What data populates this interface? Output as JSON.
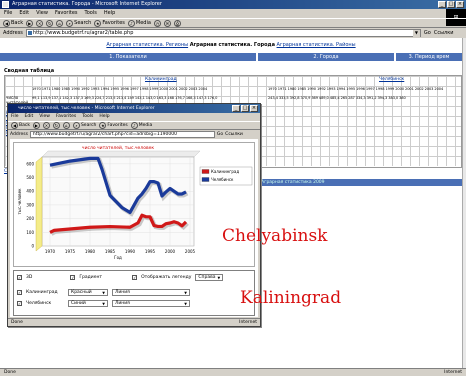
{
  "window": {
    "title": "Аграрная статистика. Города - Microsoft Internet Explorer",
    "menu": [
      "File",
      "Edit",
      "View",
      "Favorites",
      "Tools",
      "Help"
    ],
    "toolbar": {
      "back": "Back",
      "search": "Search",
      "favorites": "Favorites",
      "media": "Media"
    },
    "address_label": "Address",
    "address": "http://www.budgetrf.ru/agrar2/table.php",
    "go": "Go",
    "links": "Ссылки"
  },
  "page": {
    "nav": {
      "link1": "Аграрная статистика. Регионы",
      "current": "Аграрная статистика. Города",
      "link2": "Аграрная статистика. Районы"
    },
    "tabs": [
      "1. Показатели",
      "2. Города",
      "3. Период врем"
    ],
    "section_title": "Сводная таблица",
    "row_header": [
      "число",
      "читателей,",
      "тыс.человек"
    ],
    "row_links": [
      "Калининград",
      "Челябинск",
      "график",
      "отбор по",
      "городам"
    ],
    "city1": "Калининград",
    "city2": "Челябинск",
    "years_left": "1970 1971 1980 1985 1990 1992 1993 1994 1995 1996 1997 1998 1999 2000 2001 2002 2003 2004",
    "cells_left": "99,1 113,9 137,1 142,3 137,3 169,3 224,7 213,5 213,4 149 143,1 143,0 163,3 168 176,7 168,3 147,3 176,0",
    "years_right": "1970 1971 1980 1985 1990 1992 1993 1994 1995 1996 1997 1998 1999 2000 2001 2002 2003 2004",
    "cells_right": "243,4 333,5 392,8 370,9 369 489,0 485,4 265 287 334,3 391,2 394,3 383,0 380",
    "bottom_link": "Скачать в формате XLS",
    "strip_text": "Аграрная статистика 2009"
  },
  "popup": {
    "title": "число читателей, тыс.человек - Microsoft Internet Explorer",
    "menu": [
      "File",
      "Edit",
      "View",
      "Favorites",
      "Tools",
      "Help"
    ],
    "toolbar": {
      "back": "Back",
      "search": "Search",
      "favorites": "Favorites",
      "media": "Media"
    },
    "address_label": "Address",
    "address": "http://www.budgetrf.ru/agrar2/chart.php?cid=adrsbig=1190000",
    "go": "Go",
    "links": "Ссылки",
    "controls": {
      "cb_3d": "3D",
      "cb_gradient": "Градиент",
      "cb_legend": "Отображать легенду",
      "legend_pos": "Справа",
      "row1_city": "Калининград",
      "row1_color": "Красный",
      "row1_type": "Линия",
      "row2_city": "Челябинск",
      "row2_color": "Синий",
      "row2_type": "Линия"
    },
    "status_left": "Done",
    "status_right": "Internet"
  },
  "status": {
    "left": "Done",
    "right": "Internet"
  },
  "overlay": {
    "chelyabinsk": "Chelyabinsk",
    "kaliningrad": "Kaliningrad"
  },
  "chart_data": {
    "type": "line",
    "title": "число читателей, тыс.человек",
    "xlabel": "Год",
    "ylabel": "тыс.человек",
    "ylim": [
      0,
      650
    ],
    "xlim": [
      1968,
      2006
    ],
    "xticks": [
      1970,
      1975,
      1980,
      1985,
      1990,
      1995,
      2000,
      2005
    ],
    "yticks": [
      0,
      100,
      200,
      300,
      400,
      500,
      600
    ],
    "legend": "right",
    "series": [
      {
        "name": "Калининград",
        "color": "#d01818",
        "x": [
          1970,
          1971,
          1980,
          1985,
          1990,
          1992,
          1993,
          1994,
          1995,
          1996,
          1997,
          1998,
          1999,
          2000,
          2001,
          2002,
          2003,
          2004
        ],
        "y": [
          99,
          114,
          137,
          142,
          137,
          169,
          225,
          214,
          213,
          149,
          143,
          143,
          163,
          168,
          177,
          168,
          147,
          176
        ]
      },
      {
        "name": "Челябинск",
        "color": "#1a3a9a",
        "x": [
          1970,
          1975,
          1980,
          1982,
          1983,
          1985,
          1988,
          1990,
          1992,
          1993,
          1994,
          1995,
          1996,
          1997,
          1998,
          1999,
          2000,
          2001,
          2002,
          2003,
          2004
        ],
        "y": [
          590,
          620,
          640,
          640,
          560,
          370,
          280,
          245,
          350,
          380,
          420,
          470,
          470,
          460,
          365,
          395,
          420,
          400,
          380,
          380,
          395
        ]
      }
    ]
  },
  "colors": {
    "titlebar": "#0a246a",
    "tab": "#4a6fb5",
    "kaliningrad": "#d01818",
    "chelyabinsk": "#1a3a9a"
  }
}
